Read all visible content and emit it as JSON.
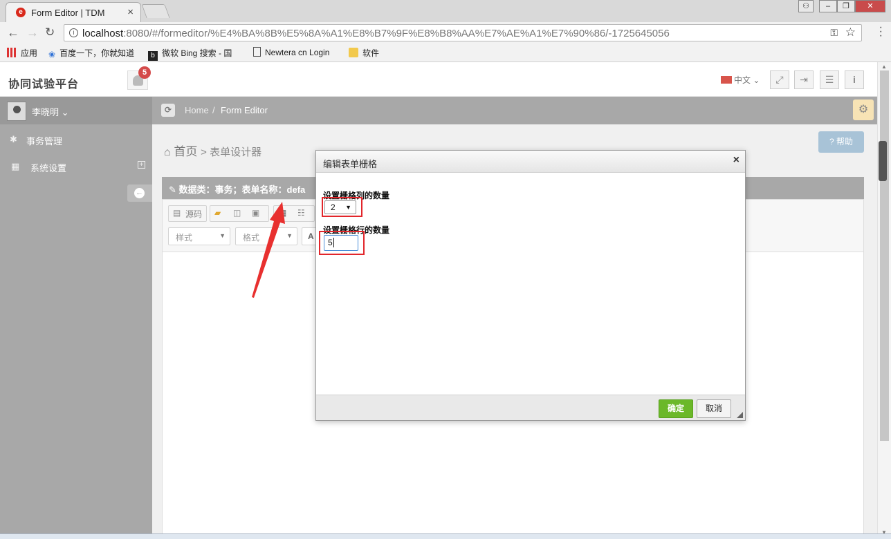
{
  "browser": {
    "tab_title": "Form Editor | TDM",
    "tab_close": "×",
    "url_host": "localhost",
    "url_rest": ":8080/#/formeditor/%E4%BA%8B%E5%8A%A1%E8%B7%9F%E8%B8%AA%E7%AE%A1%E7%90%86/-1725645056",
    "bookmarks": [
      {
        "label": "应用",
        "icon": "apps-grid-icon"
      },
      {
        "label": "百度一下，你就知道",
        "icon": "baidu-paw-icon"
      },
      {
        "label": "微软 Bing 搜索 - 国",
        "icon": "bing-icon"
      },
      {
        "label": "Newtera cn Login",
        "icon": "page-icon"
      },
      {
        "label": "软件",
        "icon": "folder-icon"
      }
    ]
  },
  "header": {
    "app_title": "协同试验平台",
    "notification_count": "5",
    "language": "中文",
    "buttons": [
      "fullscreen-icon",
      "logout-icon",
      "menu-icon",
      "info-icon"
    ]
  },
  "sidebar": {
    "username": "李晓明",
    "items": [
      {
        "label": "事务管理",
        "icon": "bug-icon"
      },
      {
        "label": "系统设置",
        "icon": "building-icon"
      }
    ]
  },
  "breadcrumb": {
    "home": "Home",
    "separator": "/",
    "current": "Form Editor"
  },
  "page": {
    "heading": "首页",
    "subheading": "> 表单设计器",
    "help_label": "帮助",
    "panel_title": "数据类：事务；表单名称：defa"
  },
  "toolbar": {
    "source_label": "源码",
    "style_select": "样式",
    "format_select": "格式",
    "font_glyph": "A"
  },
  "dialog": {
    "title": "编辑表单栅格",
    "close": "×",
    "cols_label": "设置栅格列的数量",
    "cols_value": "2",
    "rows_label": "设置栅格行的数量",
    "rows_value": "5",
    "ok_label": "确定",
    "cancel_label": "取消"
  },
  "colors": {
    "sidebar_bg": "#a8a8a8",
    "accent_green": "#6bb829",
    "highlight_red": "#e2262b",
    "badge_red": "#d44a4a"
  }
}
